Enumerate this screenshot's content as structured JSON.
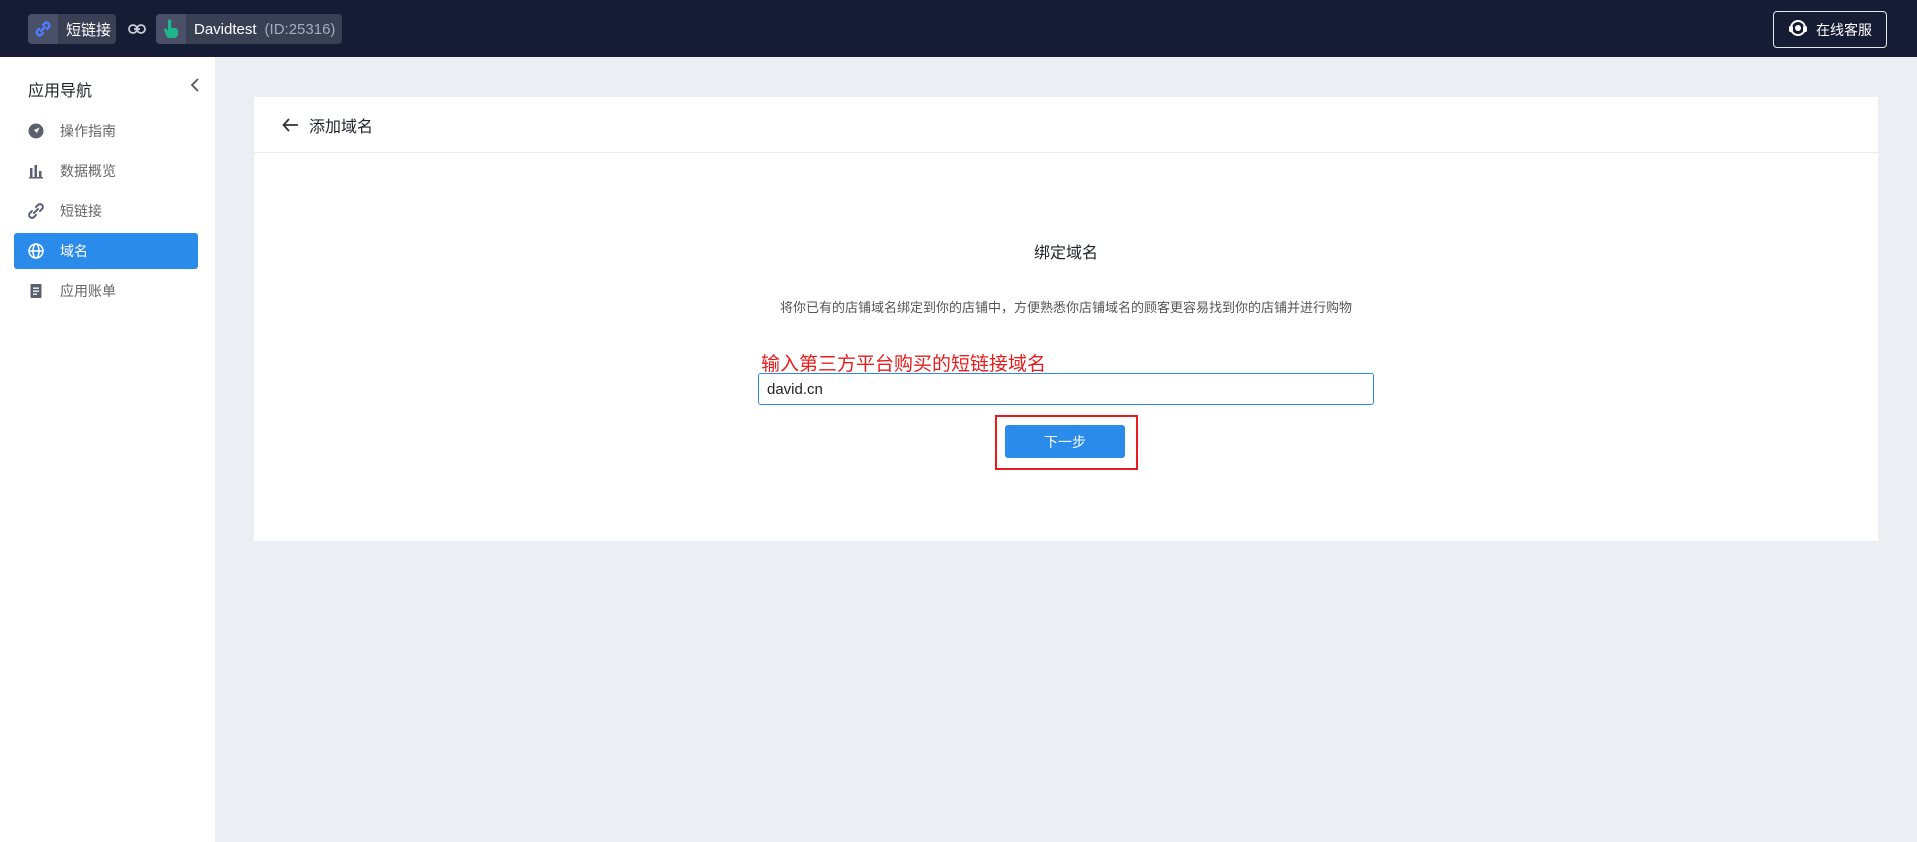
{
  "topbar": {
    "app_label": "短链接",
    "shop_name": "Davidtest",
    "shop_id": "(ID:25316)",
    "support_label": "在线客服"
  },
  "sidebar": {
    "title": "应用导航",
    "items": [
      {
        "label": "操作指南",
        "icon": "guide-icon",
        "active": false
      },
      {
        "label": "数据概览",
        "icon": "bar-chart-icon",
        "active": false
      },
      {
        "label": "短链接",
        "icon": "link-icon",
        "active": false
      },
      {
        "label": "域名",
        "icon": "globe-icon",
        "active": true
      },
      {
        "label": "应用账单",
        "icon": "bill-icon",
        "active": false
      }
    ]
  },
  "page": {
    "header_title": "添加域名",
    "form_title": "绑定域名",
    "form_desc": "将你已有的店铺域名绑定到你的店铺中，方便熟悉你店铺域名的顾客更容易找到你的店铺并进行购物",
    "annotation": "输入第三方平台购买的短链接域名",
    "domain_value": "david.cn",
    "next_label": "下一步"
  },
  "colors": {
    "topbar": "#161c33",
    "accent": "#2a8bea",
    "annotation": "#e81c1c"
  }
}
